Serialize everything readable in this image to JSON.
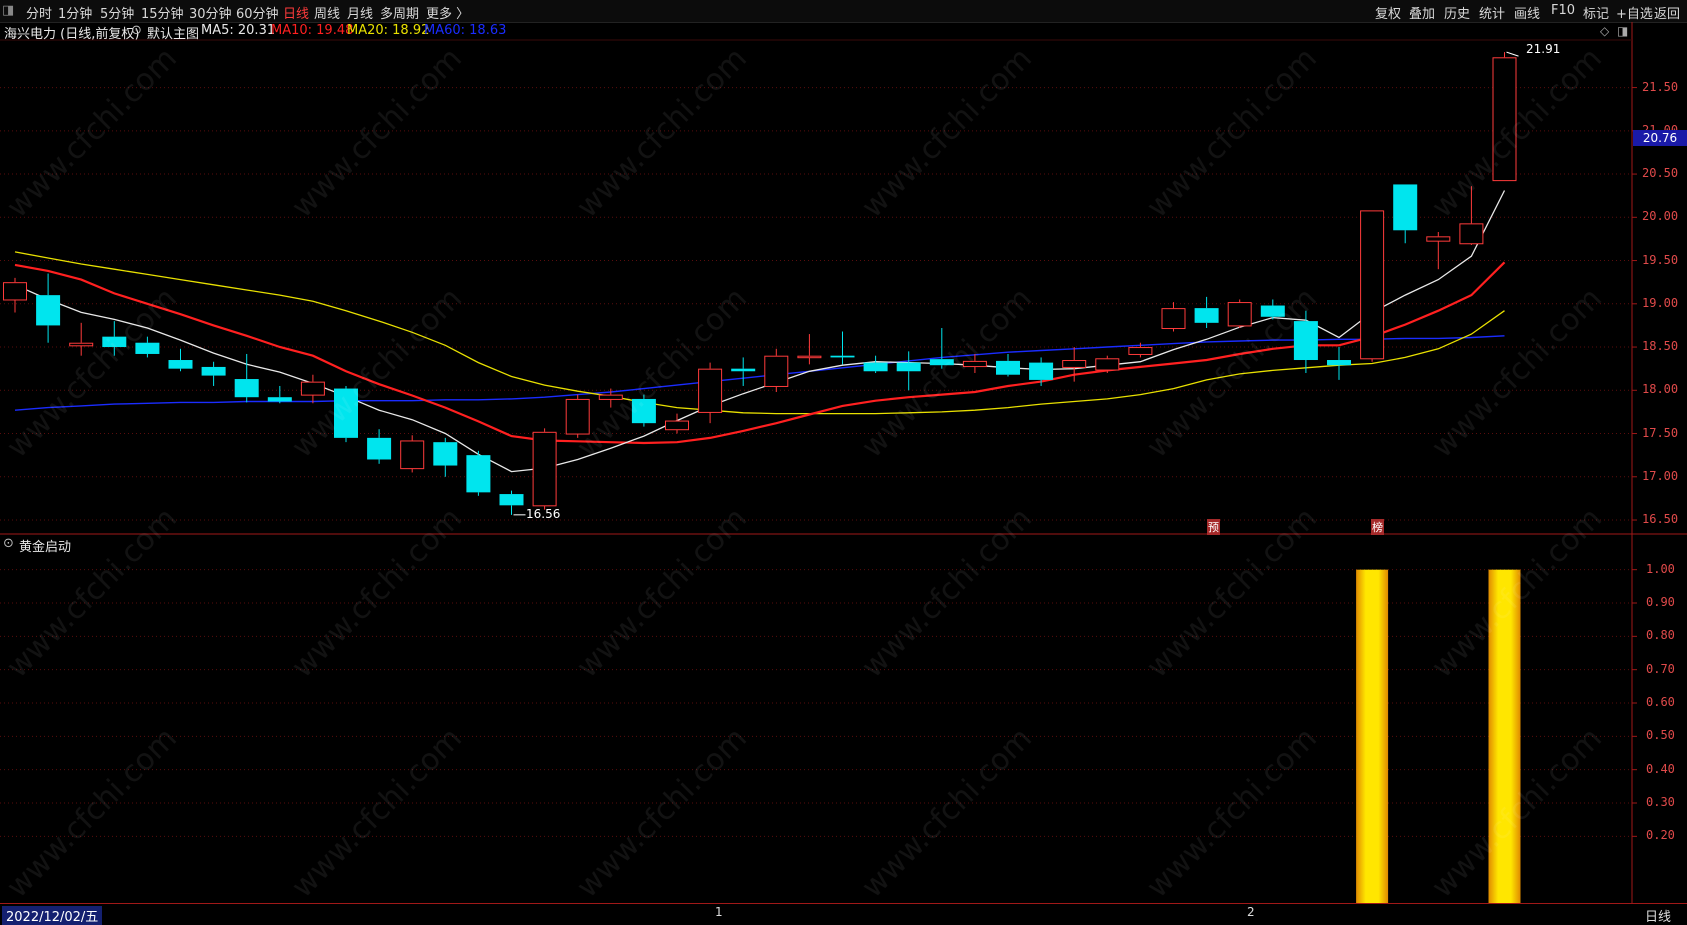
{
  "toolbar": {
    "left_items": [
      "分时",
      "1分钟",
      "5分钟",
      "15分钟",
      "30分钟",
      "60分钟",
      "日线",
      "周线",
      "月线",
      "多周期",
      "更多 〉"
    ],
    "active": "日线",
    "right_items": [
      "复权",
      "叠加",
      "历史",
      "统计",
      "画线",
      "F10",
      "标记",
      "+自选",
      "返回"
    ]
  },
  "main": {
    "stock": "海兴电力 (日线,前复权)",
    "indicator": "默认主图",
    "ma5_label": "MA5: 20.31",
    "ma10_label": "MA10: 19.48",
    "ma20_label": "MA20: 18.92",
    "ma60_label": "MA60: 18.63",
    "last_price": "20.76",
    "high_label": "21.91",
    "low_label": "16.56",
    "marker_1": "预",
    "marker_2": "榜",
    "y_ticks": [
      "21.50",
      "21.00",
      "20.50",
      "20.00",
      "19.50",
      "19.00",
      "18.50",
      "18.00",
      "17.50",
      "17.00",
      "16.50"
    ]
  },
  "sub": {
    "indicator": "黄金启动",
    "y_ticks": [
      "1.00",
      "0.90",
      "0.80",
      "0.70",
      "0.60",
      "0.50",
      "0.40",
      "0.30",
      "0.20"
    ]
  },
  "bottom": {
    "date": "2022/12/02/五",
    "period": "日线",
    "mark_1": "1",
    "mark_2": "2"
  },
  "colors": {
    "up": "#ff3b3b",
    "down": "#00e5ee",
    "ma5": "#e8e8e8",
    "ma10": "#ff2020",
    "ma20": "#e8e000",
    "ma60": "#1a2cff",
    "signal": "#ffd400"
  },
  "watermark": "www.cfchi.com",
  "chart_data": {
    "type": "candlestick",
    "candles": [
      {
        "o": 19.05,
        "h": 19.3,
        "l": 18.9,
        "c": 19.25
      },
      {
        "o": 19.1,
        "h": 19.35,
        "l": 18.55,
        "c": 18.75
      },
      {
        "o": 18.52,
        "h": 18.78,
        "l": 18.4,
        "c": 18.55
      },
      {
        "o": 18.62,
        "h": 18.8,
        "l": 18.4,
        "c": 18.5
      },
      {
        "o": 18.55,
        "h": 18.62,
        "l": 18.38,
        "c": 18.42
      },
      {
        "o": 18.35,
        "h": 18.48,
        "l": 18.22,
        "c": 18.25
      },
      {
        "o": 18.27,
        "h": 18.33,
        "l": 18.05,
        "c": 18.17
      },
      {
        "o": 18.13,
        "h": 18.42,
        "l": 17.86,
        "c": 17.92
      },
      {
        "o": 17.92,
        "h": 18.05,
        "l": 17.85,
        "c": 17.87
      },
      {
        "o": 17.95,
        "h": 18.18,
        "l": 17.85,
        "c": 18.1
      },
      {
        "o": 18.02,
        "h": 18.05,
        "l": 17.4,
        "c": 17.45
      },
      {
        "o": 17.45,
        "h": 17.55,
        "l": 17.15,
        "c": 17.2
      },
      {
        "o": 17.1,
        "h": 17.48,
        "l": 17.05,
        "c": 17.42
      },
      {
        "o": 17.4,
        "h": 17.45,
        "l": 17.0,
        "c": 17.13
      },
      {
        "o": 17.25,
        "h": 17.3,
        "l": 16.78,
        "c": 16.82
      },
      {
        "o": 16.8,
        "h": 16.84,
        "l": 16.56,
        "c": 16.67
      },
      {
        "o": 16.67,
        "h": 17.56,
        "l": 16.62,
        "c": 17.52
      },
      {
        "o": 17.5,
        "h": 17.95,
        "l": 17.45,
        "c": 17.9
      },
      {
        "o": 17.9,
        "h": 18.02,
        "l": 17.8,
        "c": 17.95
      },
      {
        "o": 17.9,
        "h": 17.95,
        "l": 17.58,
        "c": 17.62
      },
      {
        "o": 17.55,
        "h": 17.73,
        "l": 17.5,
        "c": 17.65
      },
      {
        "o": 17.75,
        "h": 18.32,
        "l": 17.62,
        "c": 18.25
      },
      {
        "o": 18.25,
        "h": 18.38,
        "l": 18.05,
        "c": 18.22
      },
      {
        "o": 18.05,
        "h": 18.48,
        "l": 17.98,
        "c": 18.4
      },
      {
        "o": 18.4,
        "h": 18.65,
        "l": 18.3,
        "c": 18.4
      },
      {
        "o": 18.4,
        "h": 18.68,
        "l": 18.3,
        "c": 18.38
      },
      {
        "o": 18.32,
        "h": 18.4,
        "l": 18.2,
        "c": 18.22
      },
      {
        "o": 18.32,
        "h": 18.45,
        "l": 18.0,
        "c": 18.22
      },
      {
        "o": 18.36,
        "h": 18.72,
        "l": 18.25,
        "c": 18.29
      },
      {
        "o": 18.28,
        "h": 18.42,
        "l": 18.2,
        "c": 18.34
      },
      {
        "o": 18.34,
        "h": 18.42,
        "l": 18.16,
        "c": 18.18
      },
      {
        "o": 18.32,
        "h": 18.38,
        "l": 18.05,
        "c": 18.12
      },
      {
        "o": 18.27,
        "h": 18.5,
        "l": 18.1,
        "c": 18.35
      },
      {
        "o": 18.24,
        "h": 18.4,
        "l": 18.2,
        "c": 18.37
      },
      {
        "o": 18.42,
        "h": 18.55,
        "l": 18.38,
        "c": 18.5
      },
      {
        "o": 18.72,
        "h": 19.02,
        "l": 18.68,
        "c": 18.95
      },
      {
        "o": 18.95,
        "h": 19.08,
        "l": 18.72,
        "c": 18.78
      },
      {
        "o": 18.75,
        "h": 19.05,
        "l": 18.72,
        "c": 19.02
      },
      {
        "o": 18.98,
        "h": 19.05,
        "l": 18.82,
        "c": 18.85
      },
      {
        "o": 18.8,
        "h": 18.92,
        "l": 18.2,
        "c": 18.35
      },
      {
        "o": 18.35,
        "h": 18.5,
        "l": 18.12,
        "c": 18.29
      },
      {
        "o": 18.37,
        "h": 20.08,
        "l": 18.33,
        "c": 20.08
      },
      {
        "o": 20.38,
        "h": 20.38,
        "l": 19.7,
        "c": 19.85
      },
      {
        "o": 19.73,
        "h": 19.83,
        "l": 19.4,
        "c": 19.78
      },
      {
        "o": 19.7,
        "h": 20.36,
        "l": 19.68,
        "c": 19.93
      },
      {
        "o": 20.43,
        "h": 21.91,
        "l": 20.43,
        "c": 21.85
      }
    ],
    "ma5": [
      19.22,
      19.05,
      18.9,
      18.82,
      18.72,
      18.58,
      18.43,
      18.3,
      18.21,
      18.08,
      17.93,
      17.77,
      17.66,
      17.5,
      17.26,
      17.06,
      17.1,
      17.2,
      17.33,
      17.47,
      17.65,
      17.82,
      17.96,
      18.09,
      18.22,
      18.29,
      18.33,
      18.32,
      18.31,
      18.29,
      18.26,
      18.24,
      18.25,
      18.29,
      18.33,
      18.47,
      18.59,
      18.73,
      18.84,
      18.81,
      18.61,
      18.9,
      19.1,
      19.28,
      19.55,
      20.31
    ],
    "ma10": [
      19.45,
      19.38,
      19.28,
      19.12,
      19.0,
      18.88,
      18.75,
      18.63,
      18.5,
      18.4,
      18.22,
      18.07,
      17.94,
      17.8,
      17.64,
      17.47,
      17.42,
      17.41,
      17.4,
      17.39,
      17.4,
      17.45,
      17.53,
      17.62,
      17.72,
      17.82,
      17.88,
      17.92,
      17.95,
      17.98,
      18.05,
      18.1,
      18.18,
      18.23,
      18.27,
      18.31,
      18.35,
      18.42,
      18.48,
      18.52,
      18.52,
      18.62,
      18.76,
      18.92,
      19.1,
      19.48
    ],
    "ma20": [
      19.6,
      19.53,
      19.46,
      19.4,
      19.34,
      19.28,
      19.22,
      19.16,
      19.1,
      19.03,
      18.92,
      18.8,
      18.67,
      18.52,
      18.32,
      18.16,
      18.06,
      17.99,
      17.93,
      17.86,
      17.8,
      17.77,
      17.74,
      17.73,
      17.73,
      17.73,
      17.73,
      17.74,
      17.75,
      17.77,
      17.8,
      17.84,
      17.87,
      17.9,
      17.95,
      18.02,
      18.12,
      18.19,
      18.23,
      18.26,
      18.29,
      18.31,
      18.38,
      18.48,
      18.65,
      18.92
    ],
    "ma60": [
      17.77,
      17.8,
      17.82,
      17.84,
      17.85,
      17.86,
      17.86,
      17.87,
      17.87,
      17.87,
      17.88,
      17.88,
      17.88,
      17.89,
      17.89,
      17.9,
      17.92,
      17.95,
      17.98,
      18.02,
      18.06,
      18.1,
      18.14,
      18.18,
      18.22,
      18.26,
      18.3,
      18.34,
      18.38,
      18.41,
      18.44,
      18.46,
      18.48,
      18.5,
      18.52,
      18.54,
      18.56,
      18.57,
      18.58,
      18.58,
      18.59,
      18.59,
      18.6,
      18.6,
      18.61,
      18.63
    ],
    "signal": [
      0,
      0,
      0,
      0,
      0,
      0,
      0,
      0,
      0,
      0,
      0,
      0,
      0,
      0,
      0,
      0,
      0,
      0,
      0,
      0,
      0,
      0,
      0,
      0,
      0,
      0,
      0,
      0,
      0,
      0,
      0,
      0,
      0,
      0,
      0,
      0,
      0,
      0,
      0,
      0,
      0,
      1,
      0,
      0,
      0,
      1
    ],
    "y_range": [
      16.35,
      22.05
    ],
    "sub_y_range": [
      0,
      1.05
    ]
  }
}
